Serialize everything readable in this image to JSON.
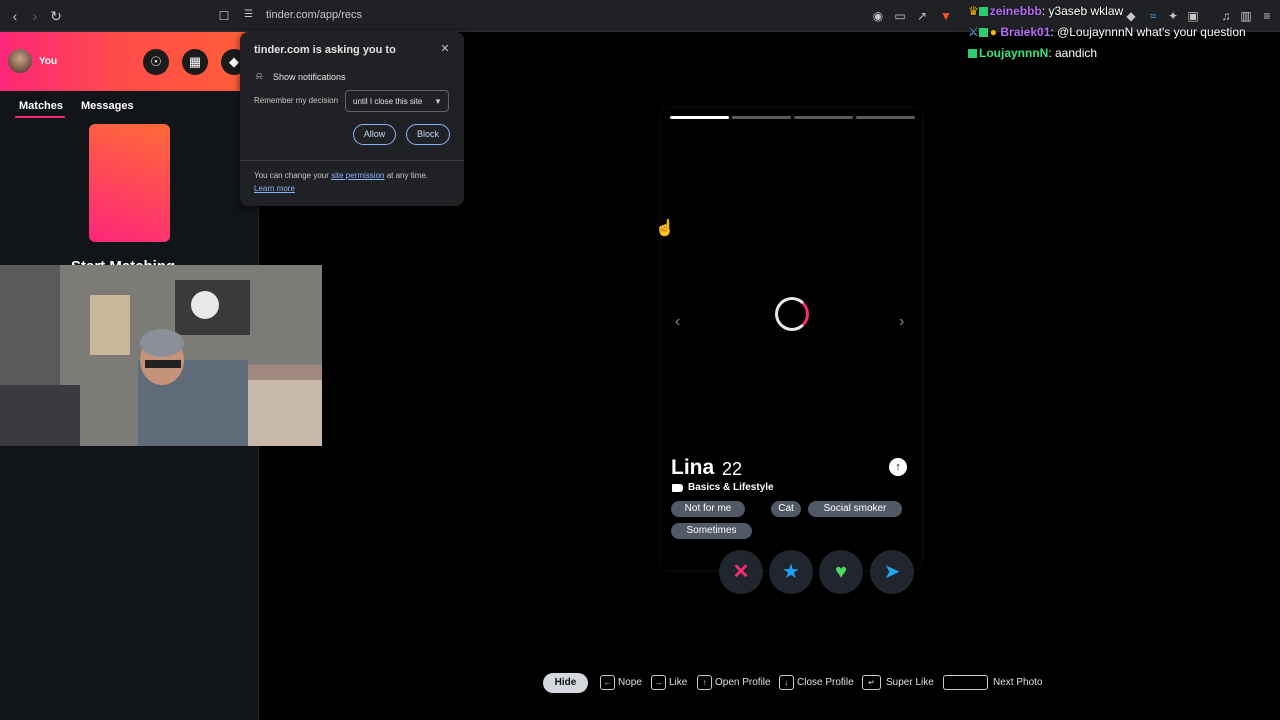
{
  "browser": {
    "url": "tinder.com/app/recs"
  },
  "sidebar": {
    "user_label": "You",
    "tabs": [
      "Matches",
      "Messages"
    ],
    "start_matching": "Start Matching"
  },
  "popup": {
    "title": "tinder.com is asking you to",
    "permission": "Show notifications",
    "remember_label": "Remember my decision",
    "remember_value": "until I close this site",
    "allow": "Allow",
    "block": "Block",
    "footer_prefix": "You can change your ",
    "footer_link": "site permission",
    "footer_suffix": " at any time.",
    "learn_more": "Learn more"
  },
  "profile": {
    "name": "Lina",
    "age": "22",
    "section": "Basics & Lifestyle",
    "chips": [
      "Not for me",
      "Cat",
      "Social smoker",
      "Sometimes"
    ],
    "photo_count": 4,
    "active_photo": 1
  },
  "shortcuts": {
    "hide": "Hide",
    "nope": "Nope",
    "like": "Like",
    "open_profile": "Open Profile",
    "close_profile": "Close Profile",
    "super_like": "Super Like",
    "next_photo": "Next Photo"
  },
  "chat": [
    {
      "user": "zeinebbb",
      "message": "y3aseb wklaw",
      "color": "#b86cf7"
    },
    {
      "user": "Braiek01",
      "message": "@LoujaynnnN what's your question",
      "color": "#b86cf7"
    },
    {
      "user": "LoujaynnnN",
      "message": "aandich",
      "color": "#39e37a"
    }
  ],
  "colors": {
    "brand_gradient_start": "#fd267a",
    "brand_gradient_end": "#ff6036",
    "nope": "#fd2b72",
    "super_like": "#1da1f2",
    "like": "#4ed964",
    "boost": "#1ea8f0"
  },
  "icons": {
    "explore": "compass-icon",
    "shop": "briefcase-icon",
    "safety": "shield-icon"
  }
}
